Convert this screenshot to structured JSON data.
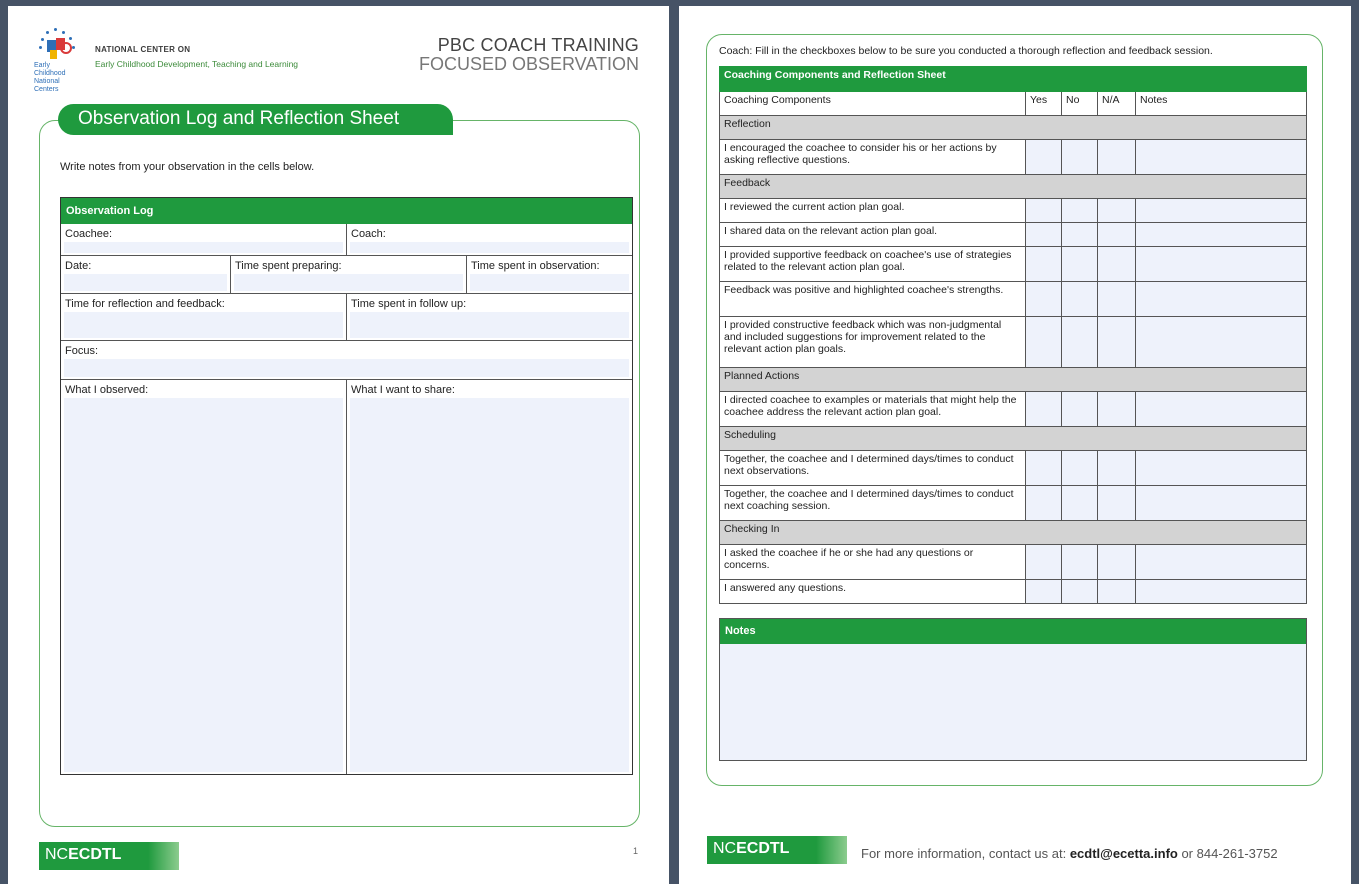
{
  "left_page": {
    "logo_text": "Early Childhood National Centers",
    "org_line1": "NATIONAL CENTER ON",
    "org_line2": "Early Childhood Development, Teaching and Learning",
    "title1": "PBC COACH TRAINING",
    "title2": "FOCUSED OBSERVATION",
    "banner": "Observation Log and Reflection Sheet",
    "intro": "Write notes from your observation in the cells below.",
    "table_title": "Observation Log",
    "fields": {
      "coachee": "Coachee:",
      "coach": "Coach:",
      "date": "Date:",
      "time_preparing": "Time spent preparing:",
      "time_observation": "Time spent in observation:",
      "time_reflection": "Time for reflection and feedback:",
      "time_followup": "Time spent in follow up:",
      "focus": "Focus:",
      "observed": "What I observed:",
      "share": "What I want to share:"
    },
    "footer_nc": "NC",
    "footer_ecdtl": "ECDTL",
    "page_number": "1"
  },
  "right_page": {
    "intro": "Coach: Fill in the checkboxes below to be sure you conducted a thorough reflection and feedback session.",
    "table_title": "Coaching Components and Reflection Sheet",
    "columns": [
      "Coaching Components",
      "Yes",
      "No",
      "N/A",
      "Notes"
    ],
    "sections": [
      {
        "name": "Reflection",
        "items": [
          "I encouraged the coachee to consider his or her actions by asking reflective questions."
        ]
      },
      {
        "name": "Feedback",
        "items": [
          "I reviewed the current action plan goal.",
          "I shared data on the relevant action plan goal.",
          "I provided supportive feedback on coachee's use of strategies related to the relevant action plan goal.",
          "Feedback was positive and highlighted coachee's strengths.",
          "I provided constructive feedback which was non-judgmental and included suggestions for improvement related to the relevant action plan goals."
        ]
      },
      {
        "name": "Planned Actions",
        "items": [
          "I directed coachee to examples or materials that might help the coachee address the relevant action plan goal."
        ]
      },
      {
        "name": "Scheduling",
        "items": [
          "Together, the coachee and I determined days/times to conduct next observations.",
          "Together, the coachee and I determined days/times to conduct next coaching session."
        ]
      },
      {
        "name": "Checking In",
        "items": [
          "I asked the coachee if he or she had any questions or concerns.",
          "I answered any questions."
        ]
      }
    ],
    "notes_title": "Notes",
    "footer_nc": "NC",
    "footer_ecdtl": "ECDTL",
    "contact_prefix": "For more information, contact us at: ",
    "contact_email": "ecdtl@ecetta.info",
    "contact_suffix": " or 844-261-3752"
  },
  "colors": {
    "green": "#1f9a3e",
    "frame": "#66b468",
    "fill": "#eef2fb",
    "section": "#d3d3d3"
  }
}
